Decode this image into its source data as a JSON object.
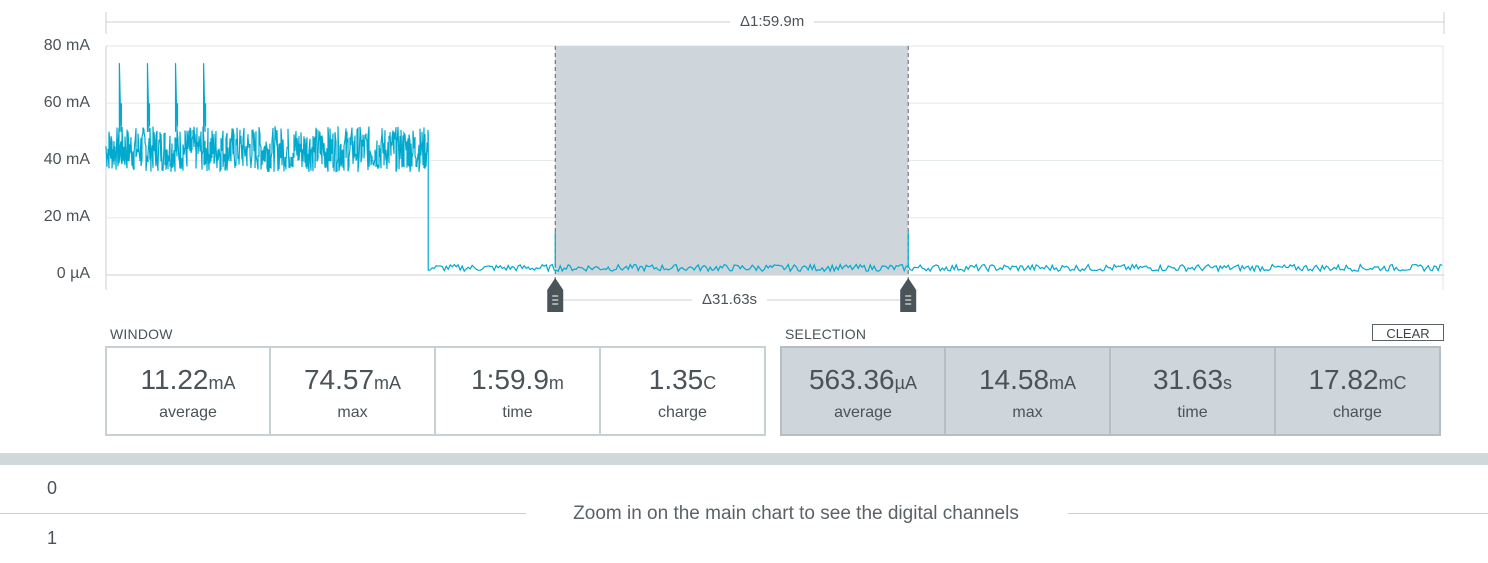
{
  "top_ruler": {
    "delta_label": "Δ1:59.9m"
  },
  "y_axis": {
    "ticks": [
      "80 mA",
      "60 mA",
      "40 mA",
      "20 mA",
      "0 µA"
    ]
  },
  "selection_ruler": {
    "delta_label": "Δ31.63s"
  },
  "chart_data": {
    "type": "line",
    "xlabel": "",
    "ylabel": "",
    "ylim_mA": [
      0,
      80
    ],
    "series": [
      {
        "segments": [
          {
            "x_frac": [
              0,
              0.241
            ],
            "y_range_mA": [
              36,
              52
            ],
            "spikes_mA": [
              74,
              74,
              74,
              74
            ]
          },
          {
            "x_frac": [
              0.241,
              1.0
            ],
            "y_mA": 2.5,
            "spikes_mA": [
              15,
              15
            ]
          }
        ]
      }
    ],
    "selection_frac": [
      0.336,
      0.6
    ]
  },
  "window": {
    "label": "WINDOW",
    "stats": [
      {
        "value": "11.22",
        "unit": "mA",
        "label": "average"
      },
      {
        "value": "74.57",
        "unit": "mA",
        "label": "max"
      },
      {
        "value": "1:59.9",
        "unit": "m",
        "label": "time"
      },
      {
        "value": "1.35",
        "unit": "C",
        "label": "charge"
      }
    ]
  },
  "selection": {
    "label": "SELECTION",
    "clear_label": "CLEAR",
    "stats": [
      {
        "value": "563.36",
        "unit": "µA",
        "label": "average"
      },
      {
        "value": "14.58",
        "unit": "mA",
        "label": "max"
      },
      {
        "value": "31.63",
        "unit": "s",
        "label": "time"
      },
      {
        "value": "17.82",
        "unit": "mC",
        "label": "charge"
      }
    ]
  },
  "digital": {
    "channels": [
      "0",
      "1"
    ],
    "message": "Zoom in on the main chart to see the digital channels"
  },
  "colors": {
    "signal": "#00a9ce",
    "selection_fill": "#ced6db",
    "grid": "#e6ebee"
  }
}
